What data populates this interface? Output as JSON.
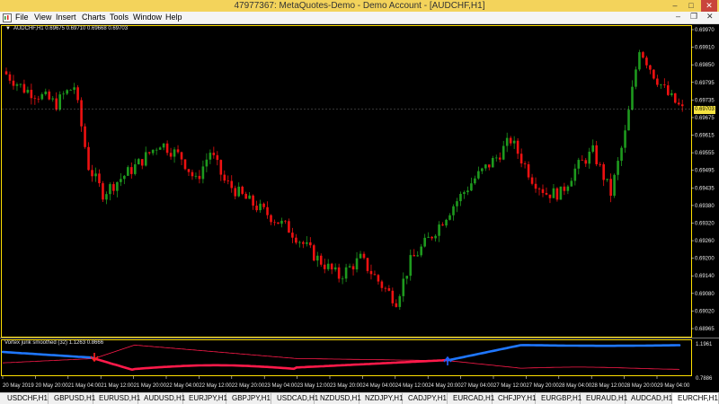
{
  "window": {
    "title": "47977367: MetaQuotes-Demo - Demo Account - [AUDCHF,H1]",
    "minimize": "–",
    "maximize": "□",
    "close": "✕"
  },
  "menu": {
    "items": [
      "File",
      "View",
      "Insert",
      "Charts",
      "Tools",
      "Window",
      "Help"
    ],
    "mdi_minimize": "–",
    "mdi_restore": "❐",
    "mdi_close": "✕"
  },
  "chart": {
    "header_arrow": "▼",
    "header": "AUDCHF,H1  0.69675 0.69710 0.69668 0.69703",
    "current_price": "0.69703",
    "price_axis": [
      "0.69970",
      "0.69910",
      "0.69850",
      "0.69795",
      "0.69735",
      "0.69675",
      "0.69615",
      "0.69555",
      "0.69495",
      "0.69435",
      "0.69380",
      "0.69320",
      "0.69260",
      "0.69200",
      "0.69140",
      "0.69080",
      "0.69020",
      "0.68965"
    ],
    "time_axis": [
      "20 May 2019",
      "20 May 20:00",
      "21 May 04:00",
      "21 May 12:00",
      "21 May 20:00",
      "22 May 04:00",
      "22 May 12:00",
      "22 May 20:00",
      "23 May 04:00",
      "23 May 12:00",
      "23 May 20:00",
      "24 May 04:00",
      "24 May 12:00",
      "24 May 20:00",
      "27 May 04:00",
      "27 May 12:00",
      "27 May 20:00",
      "28 May 04:00",
      "28 May 12:00",
      "28 May 20:00",
      "29 May 04:00"
    ],
    "bull_color": "#1e9a1e",
    "bear_color": "#ee1111",
    "grid_color": "#ffe000"
  },
  "indicator": {
    "header": "Vortex jurik smoothed (32) 1.1263 0.8666",
    "max_label": "1.1961",
    "min_label": "0.7886",
    "up_color": "#1f77ff",
    "down_color": "#ff1a4a"
  },
  "tabs": [
    "USDCHF,H1",
    "GBPUSD,H1",
    "EURUSD,H1",
    "AUDUSD,H1",
    "EURJPY,H1",
    "GBPJPY,H1",
    "USDCAD,H1",
    "NZDUSD,H1",
    "NZDJPY,H1",
    "CADJPY,H1",
    "EURCAD,H1",
    "CHFJPY,H1",
    "EURGBP,H1",
    "EURAUD,H1",
    "AUDCAD,H1",
    "EURCHF,H1"
  ]
}
